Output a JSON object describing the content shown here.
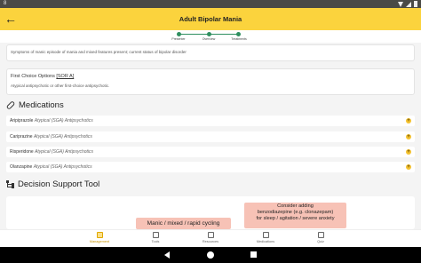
{
  "status_bar": {
    "time": "8"
  },
  "app_bar": {
    "title": "Adult Bipolar Mania"
  },
  "stepper": {
    "steps": [
      "Presenter",
      "Overview",
      "Treatments"
    ]
  },
  "summary_card": {
    "text": "Symptoms of manic episode of mania and mixed features present; current status of bipolar disorder"
  },
  "first_choice": {
    "label": "First Choice Options",
    "ref": "[SOR A]",
    "text": "Atypical antipsychotic or other first-choice antipsychotic."
  },
  "medications_section": {
    "title": "Medications",
    "icon": "pill-icon"
  },
  "medications": [
    {
      "name": "Aripiprazole",
      "class": "Atypical (SGA) Antipsychotics"
    },
    {
      "name": "Cariprazine",
      "class": "Atypical (SGA) Antipsychotics"
    },
    {
      "name": "Risperidone",
      "class": "Atypical (SGA) Antipsychotics"
    },
    {
      "name": "Olanzapine",
      "class": "Atypical (SGA) Antipsychotics"
    }
  ],
  "decision_section": {
    "title": "Decision Support Tool",
    "icon": "tree-icon"
  },
  "decision_nodes": {
    "manic": "Manic / mixed / rapid cycling",
    "benzo_line1": "Consider adding",
    "benzo_line2": "benzodiazepine (e.g. clonazepam)",
    "benzo_line3": "for sleep / agitation / severe anxiety"
  },
  "bottom_nav": [
    {
      "label": "Management",
      "active": true
    },
    {
      "label": "Tools",
      "active": false
    },
    {
      "label": "Resources",
      "active": false
    },
    {
      "label": "Medications",
      "active": false
    },
    {
      "label": "Quiz",
      "active": false
    }
  ],
  "colors": {
    "accent": "#fbd33d",
    "step": "#2f8f5f",
    "node": "#f7c2b6"
  }
}
